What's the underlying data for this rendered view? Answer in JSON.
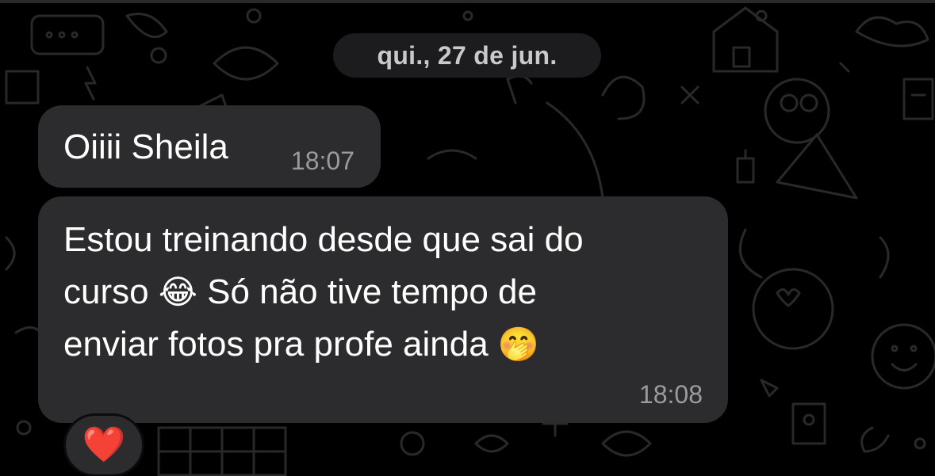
{
  "chat": {
    "date_separator": "qui., 27 de jun.",
    "messages": [
      {
        "text": "Oiiii Sheila",
        "time": "18:07"
      },
      {
        "line1": "Estou treinando desde que sai do",
        "line2_before_emoji": "curso",
        "line2_emoji": "😂",
        "line2_after_emoji": "Só não tive tempo de",
        "line3_before_emoji": "enviar fotos pra profe ainda",
        "line3_emoji": "🤭",
        "time": "18:08"
      }
    ],
    "reaction": {
      "emoji": "❤️"
    }
  },
  "colors": {
    "background": "#000000",
    "bubble": "#2c2c2e",
    "date_pill": "#1c1c1e",
    "timestamp": "#9a9a9f",
    "text": "#ffffff"
  },
  "icons": [
    "heart-reaction-icon",
    "laughing-tears-emoji",
    "hand-over-mouth-emoji"
  ]
}
